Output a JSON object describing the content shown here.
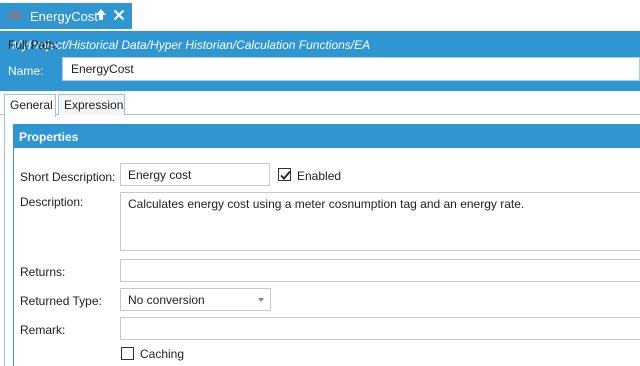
{
  "tab": {
    "icon": "function-icon",
    "icon_text": "(x)",
    "label": "EnergyCost",
    "pin_icon": "pin-icon",
    "close_icon": "close-icon"
  },
  "header": {
    "full_path_label": "Full Path:",
    "full_path_value": "MyProject/Historical Data/Hyper Historian/Calculation Functions/EA",
    "name_label": "Name:",
    "name_value": "EnergyCost"
  },
  "property_tabs": [
    {
      "label": "General",
      "selected": true
    },
    {
      "label": "Expression",
      "selected": false
    }
  ],
  "properties": {
    "title": "Properties",
    "short_description_label": "Short Description:",
    "short_description_value": "Energy cost",
    "enabled_label": "Enabled",
    "enabled_checked": true,
    "description_label": "Description:",
    "description_value": "Calculates energy cost using a meter cosnumption tag and an energy rate.",
    "returns_label": "Returns:",
    "returns_value": "",
    "returned_type_label": "Returned Type:",
    "returned_type_value": "No conversion",
    "remark_label": "Remark:",
    "remark_value": "",
    "caching_label": "Caching",
    "caching_checked": false
  },
  "colors": {
    "accent": "#2f96d2",
    "tab_border": "#9fc3dc"
  }
}
